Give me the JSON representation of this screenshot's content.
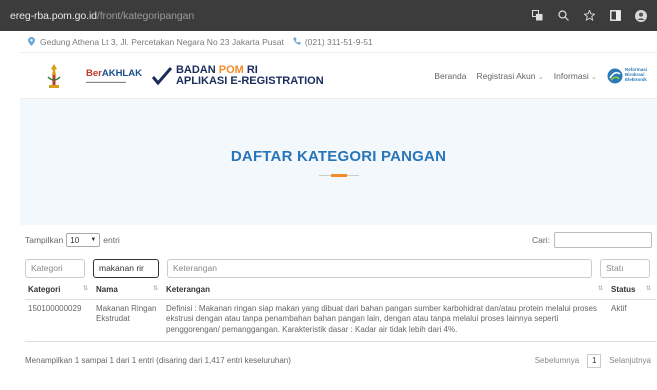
{
  "browser": {
    "url_host": "ereg-rba.pom.go.id",
    "url_path": "/front/kategoripangan",
    "icons": [
      "translate-icon",
      "zoom-icon",
      "star-icon",
      "sidepanel-icon",
      "profile-icon"
    ]
  },
  "topbar": {
    "address": "Gedung Athena Lt 3, Jl. Percetakan Negara No 23 Jakarta Pusat",
    "phone": "(021) 311-51-9-51"
  },
  "header": {
    "berakhlak": "BerAKHLAK",
    "bpom_line1": "BADAN POM RI",
    "bpom_line2": "APLIKASI E-REGISTRATION",
    "nav": [
      "Beranda",
      "Registrasi Akun",
      "Informasi"
    ],
    "rbe": [
      "Reformasi",
      "Birokrasi",
      "Elektronik"
    ]
  },
  "hero": {
    "title": "DAFTAR KATEGORI PANGAN"
  },
  "controls": {
    "show_label": "Tampilkan",
    "page_size": "10",
    "entries_label": "entri",
    "search_label": "Cari:"
  },
  "filters": {
    "kategori_placeholder": "Kategori",
    "nama_value": "makanan rir",
    "keterangan_placeholder": "Keterangan",
    "status_placeholder": "Statı"
  },
  "table": {
    "headers": [
      "Kategori",
      "Nama",
      "Keterangan",
      "Status"
    ],
    "rows": [
      {
        "kategori": "150100000029",
        "nama": "Makanan Ringan Ekstrudat",
        "keterangan": "Definisi : Makanan ringan siap makan yang dibuat dari bahan pangan sumber karbohidrat dan/atau protein melalui proses ekstrusi dengan atau tanpa penambahan bahan pangan lain, dengan atau tanpa melalui proses lainnya seperti penggorengan/ pemanggangan. Karakteristik dasar : Kadar air tidak lebih dari 4%.",
        "status": "Aktif"
      }
    ]
  },
  "footer": {
    "info": "Menampilkan 1 sampai 1 dari 1 entri (disaring dari 1,417 entri keseluruhan)",
    "prev": "Sebelumnya",
    "page": "1",
    "next": "Selanjutnya"
  },
  "colors": {
    "title_blue": "#2a74b8",
    "accent_orange": "#f28c28",
    "hero_bg": "#f2f8fc",
    "browser_bar": "#3c3c3c"
  }
}
